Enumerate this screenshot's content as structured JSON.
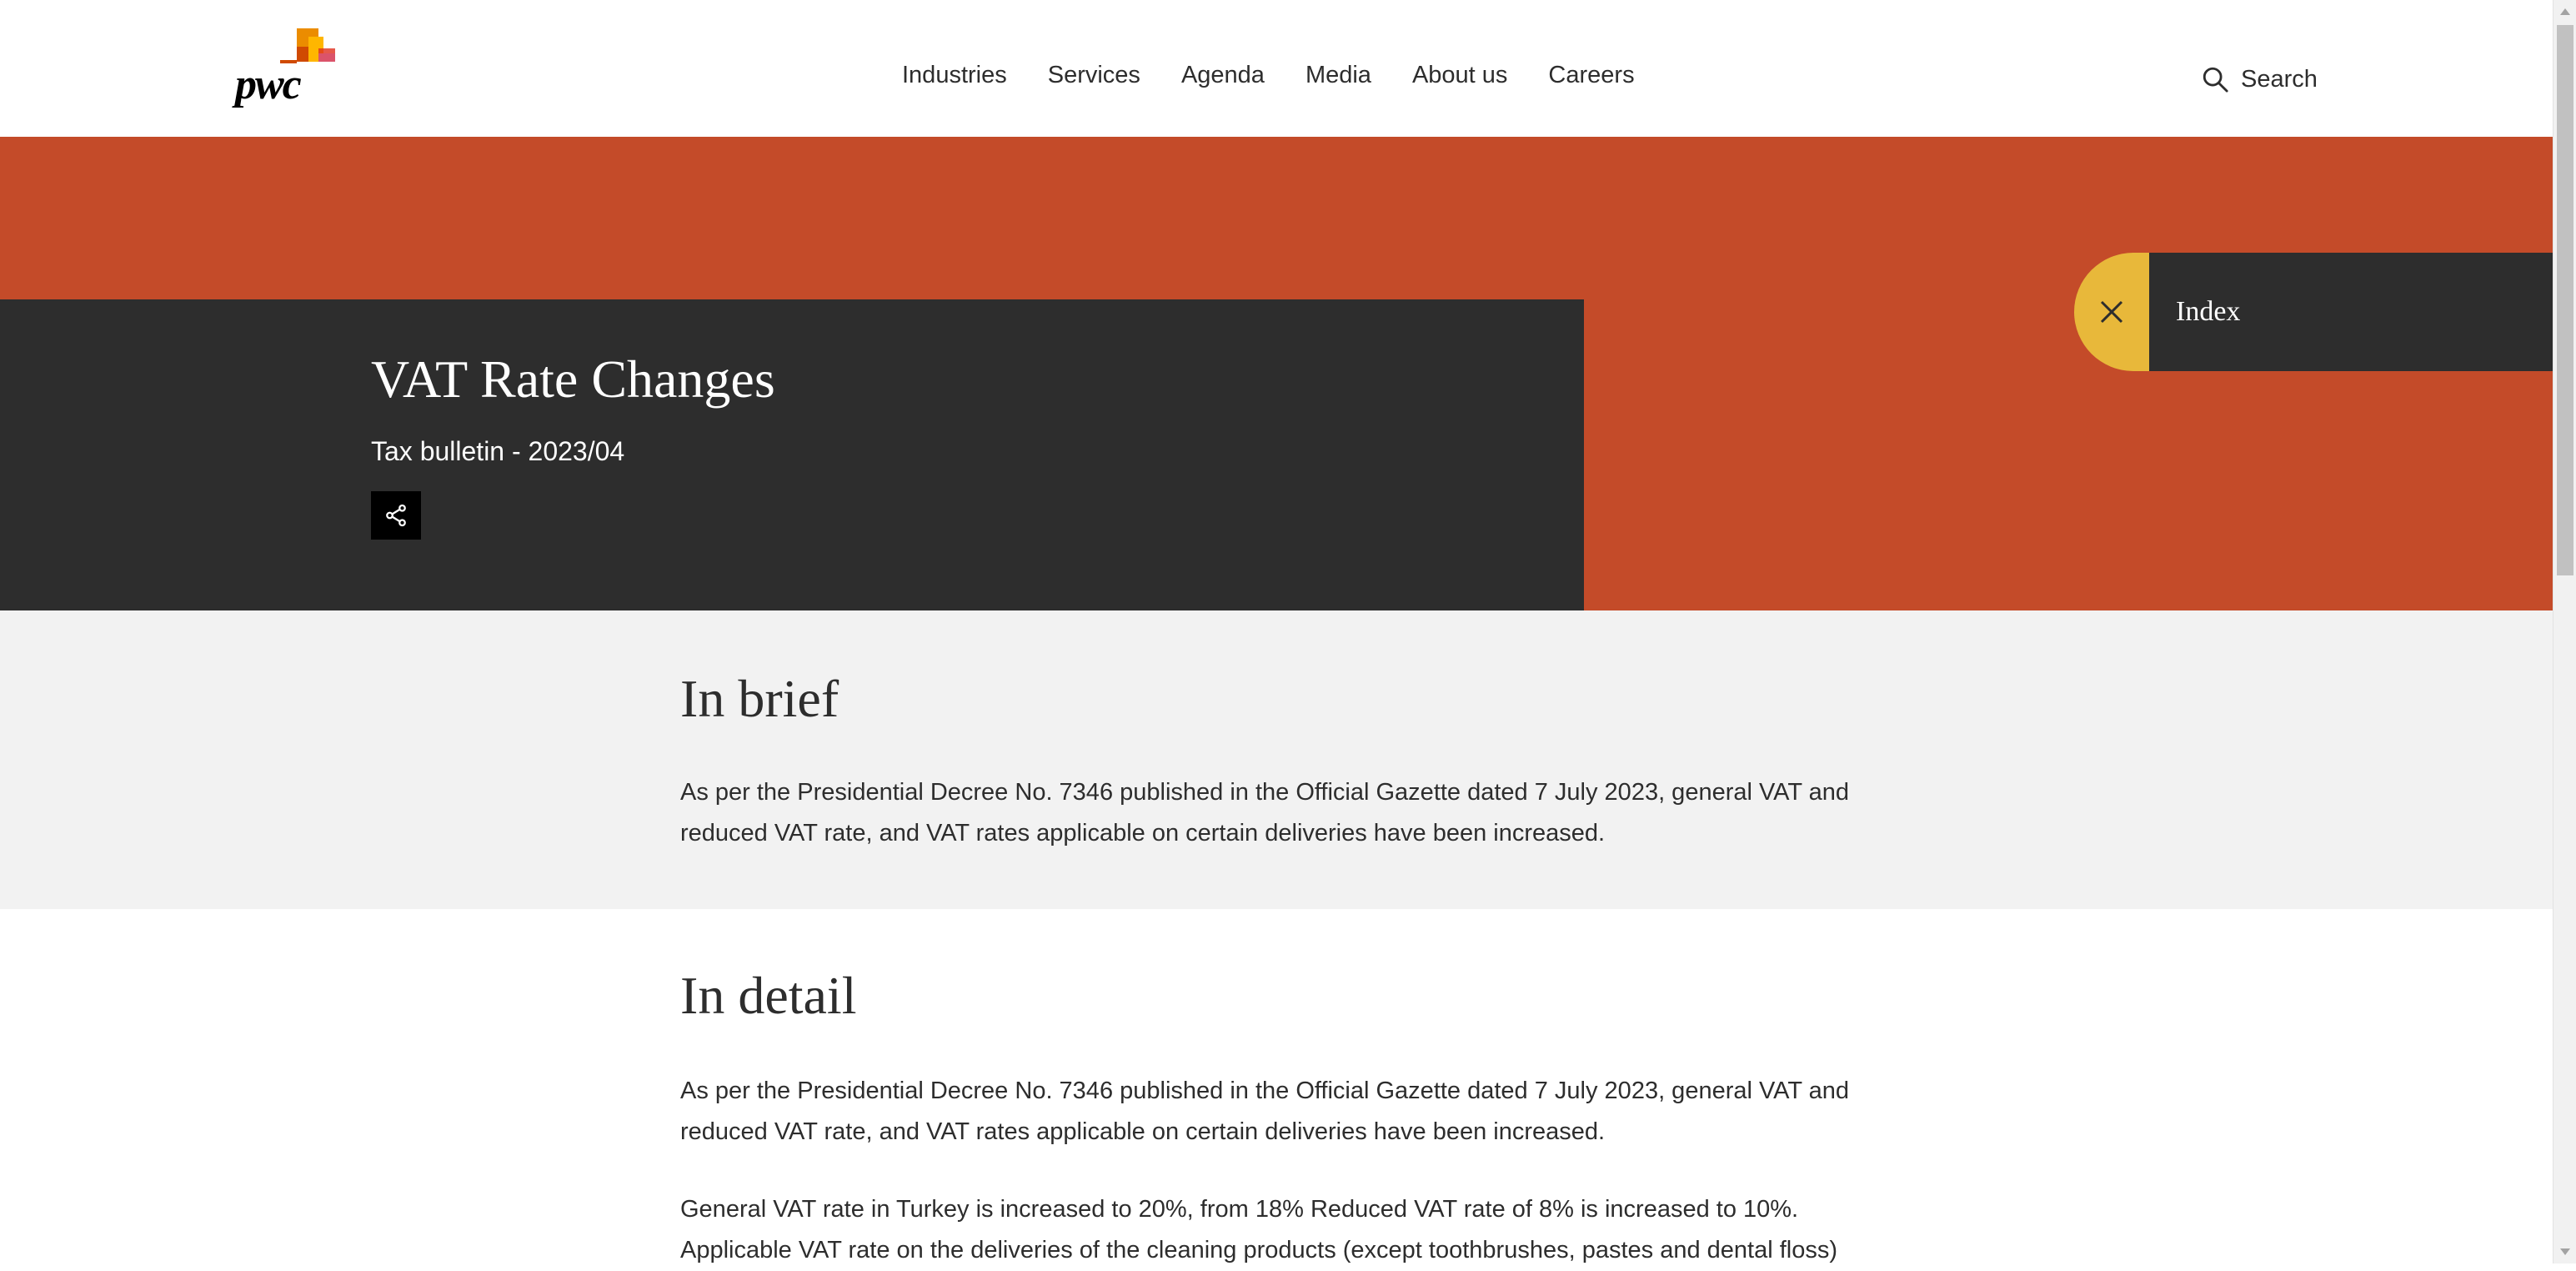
{
  "header": {
    "logo_text": "pwc",
    "nav": [
      "Industries",
      "Services",
      "Agenda",
      "Media",
      "About us",
      "Careers"
    ],
    "search_label": "Search"
  },
  "hero": {
    "title": "VAT Rate Changes",
    "subtitle": "Tax bulletin - 2023/04",
    "index_label": "Index"
  },
  "brief": {
    "heading": "In brief",
    "body": "As per the Presidential Decree No. 7346 published in the Official Gazette dated 7 July 2023, general VAT and reduced VAT rate, and VAT rates applicable on certain deliveries have been increased."
  },
  "detail": {
    "heading": "In detail",
    "paragraphs": [
      "As per the Presidential Decree No. 7346 published in the Official Gazette dated 7 July 2023, general VAT and reduced VAT rate, and VAT rates applicable on certain deliveries have been increased.",
      "General VAT rate in Turkey is increased to 20%, from 18% Reduced VAT rate of 8% is increased to 10%. Applicable VAT rate on the deliveries of the cleaning products (except toothbrushes, pastes and dental floss)"
    ]
  },
  "colors": {
    "brand_orange": "#c44b29",
    "dark_panel": "#2d2d2d",
    "index_yellow": "#e8b83a",
    "brief_bg": "#f2f2f2"
  },
  "icons": {
    "search": "search-icon",
    "share": "share-icon",
    "close": "close-icon"
  }
}
